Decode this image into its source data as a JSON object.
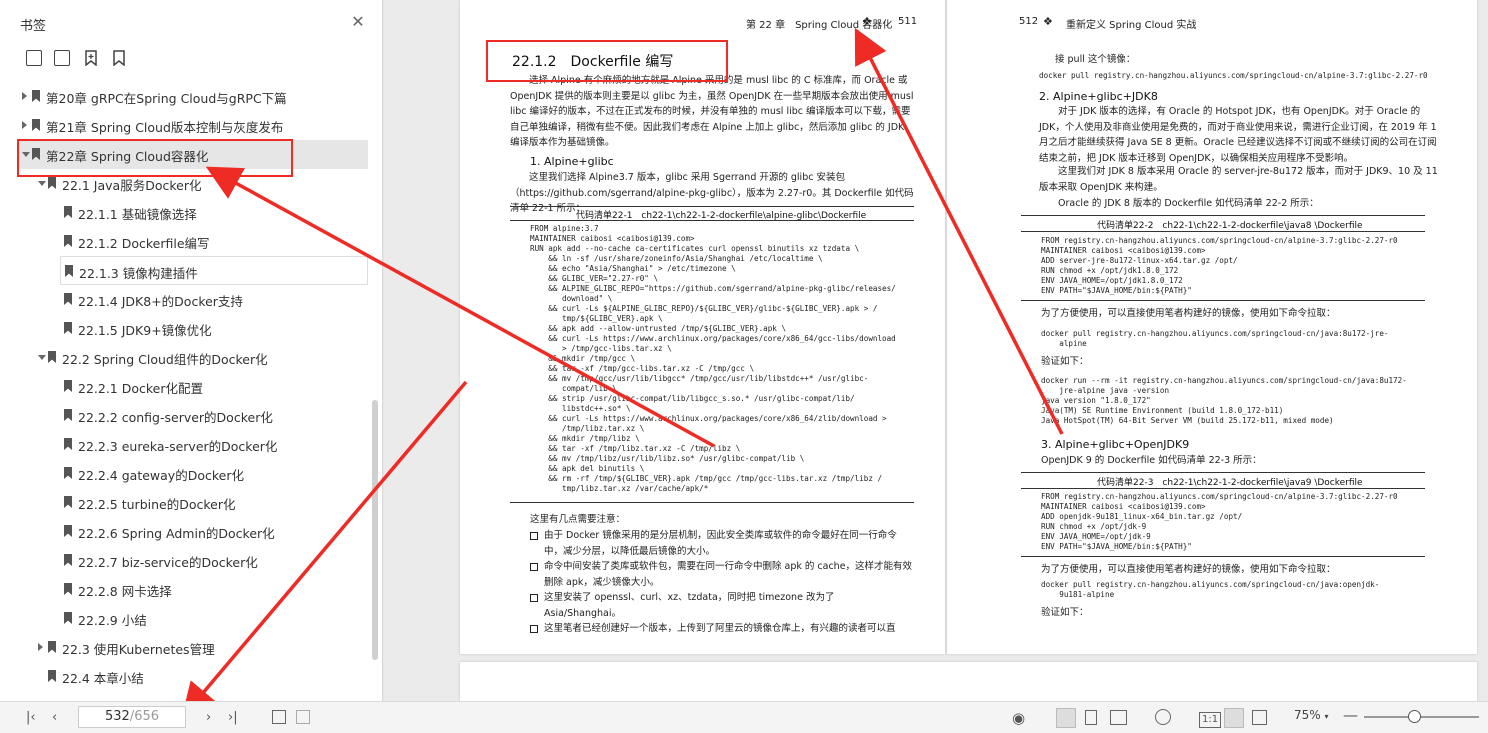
{
  "sidebar": {
    "title": "书签",
    "items": [
      {
        "label": "第20章 gRPC在Spring Cloud与gRPC下篇",
        "state": "collapsed"
      },
      {
        "label": "第21章 Spring Cloud版本控制与灰度发布",
        "state": "collapsed"
      },
      {
        "label": "第22章 Spring Cloud容器化",
        "state": "expanded"
      },
      {
        "label": "22.1 Java服务Docker化",
        "state": "expanded"
      },
      {
        "label": "22.1.1 基础镜像选择"
      },
      {
        "label": "22.1.2 Dockerfile编写"
      },
      {
        "label": "22.1.3 镜像构建插件"
      },
      {
        "label": "22.1.4 JDK8+的Docker支持"
      },
      {
        "label": "22.1.5 JDK9+镜像优化"
      },
      {
        "label": "22.2 Spring Cloud组件的Docker化",
        "state": "expanded"
      },
      {
        "label": "22.2.1 Docker化配置"
      },
      {
        "label": "22.2.2 config-server的Docker化"
      },
      {
        "label": "22.2.3 eureka-server的Docker化"
      },
      {
        "label": "22.2.4 gateway的Docker化"
      },
      {
        "label": "22.2.5 turbine的Docker化"
      },
      {
        "label": "22.2.6 Spring Admin的Docker化"
      },
      {
        "label": "22.2.7 biz-service的Docker化"
      },
      {
        "label": "22.2.8 网卡选择"
      },
      {
        "label": "22.2.9 小结"
      },
      {
        "label": "22.3 使用Kubernetes管理",
        "state": "collapsed"
      },
      {
        "label": "22.4 本章小结"
      }
    ]
  },
  "left_page": {
    "header": "第 22 章　Spring Cloud 容器化",
    "page_number": "511",
    "section_title": "22.1.2　Dockerfile 编写",
    "intro": "选择 Alpine 有个麻烦的地方就是 Alpine 采用的是 musl libc 的 C 标准库，而 Oracle 或 OpenJDK 提供的版本则主要是以 glibc 为主，虽然 OpenJDK 在一些早期版本会放出使用 musl libc 编译好的版本，不过在正式发布的时候，并没有单独的 musl libc 编译版本可以下载，需要自己单独编译，稍微有些不便。因此我们考虑在 Alpine 上加上 glibc，然后添加 glibc 的 JDK 编译版本作为基础镜像。",
    "sub1": "1. Alpine+glibc",
    "sub1_text": "这里我们选择 Alpine3.7 版本，glibc 采用 Sgerrand 开源的 glibc 安装包（https://github.com/sgerrand/alpine-pkg-glibc），版本为 2.27-r0。其 Dockerfile 如代码清单 22-1 所示：",
    "listing1": "代码清单22-1　ch22-1\\ch22-1-2-dockerfile\\alpine-glibc\\Dockerfile",
    "code1": "FROM alpine:3.7\nMAINTAINER caibosi <caibosi@139.com>\nRUN apk add --no-cache ca-certificates curl openssl binutils xz tzdata \\\n    && ln -sf /usr/share/zoneinfo/Asia/Shanghai /etc/localtime \\\n    && echo \"Asia/Shanghai\" > /etc/timezone \\\n    && GLIBC_VER=\"2.27-r0\" \\\n    && ALPINE_GLIBC_REPO=\"https://github.com/sgerrand/alpine-pkg-glibc/releases/\n       download\" \\\n    && curl -Ls ${ALPINE_GLIBC_REPO}/${GLIBC_VER}/glibc-${GLIBC_VER}.apk > /\n       tmp/${GLIBC_VER}.apk \\\n    && apk add --allow-untrusted /tmp/${GLIBC_VER}.apk \\\n    && curl -Ls https://www.archlinux.org/packages/core/x86_64/gcc-libs/download\n       > /tmp/gcc-libs.tar.xz \\\n    && mkdir /tmp/gcc \\\n    && tar -xf /tmp/gcc-libs.tar.xz -C /tmp/gcc \\\n    && mv /tmp/gcc/usr/lib/libgcc* /tmp/gcc/usr/lib/libstdc++* /usr/glibc-\n       compat/lib \\\n    && strip /usr/glibc-compat/lib/libgcc_s.so.* /usr/glibc-compat/lib/\n       libstdc++.so* \\\n    && curl -Ls https://www.archlinux.org/packages/core/x86_64/zlib/download >\n       /tmp/libz.tar.xz \\\n    && mkdir /tmp/libz \\\n    && tar -xf /tmp/libz.tar.xz -C /tmp/libz \\\n    && mv /tmp/libz/usr/lib/libz.so* /usr/glibc-compat/lib \\\n    && apk del binutils \\\n    && rm -rf /tmp/${GLIBC_VER}.apk /tmp/gcc /tmp/gcc-libs.tar.xz /tmp/libz /\n       tmp/libz.tar.xz /var/cache/apk/*",
    "notes_intro": "这里有几点需要注意：",
    "bullets": [
      "由于 Docker 镜像采用的是分层机制，因此安全类库或软件的命令最好在同一行命令中，减少分层，以降低最后镜像的大小。",
      "命令中间安装了类库或软件包，需要在同一行命令中删除 apk 的 cache，这样才能有效删除 apk，减少镜像大小。",
      "这里安装了 openssl、curl、xz、tzdata，同时把 timezone 改为了 Asia/Shanghai。",
      "这里笔者已经创建好一个版本，上传到了阿里云的镜像仓库上，有兴趣的读者可以直"
    ]
  },
  "right_page": {
    "page_number": "512",
    "header": "重新定义 Spring Cloud 实战",
    "pull_label": "接 pull 这个镜像：",
    "pull_cmd": "docker pull registry.cn-hangzhou.aliyuncs.com/springcloud-cn/alpine-3.7:glibc-2.27-r0",
    "sub2": "2. Alpine+glibc+JDK8",
    "sub2_text": "对于 JDK 版本的选择，有 Oracle 的 Hotspot JDK，也有 OpenJDK。对于 Oracle 的 JDK，个人使用及非商业使用是免费的，而对于商业使用来说，需进行企业订阅，在 2019 年 1 月之后才能继续获得 Java SE 8 更新。Oracle 已经建议选择不订阅或不继续订阅的公司在订阅结束之前，把 JDK 版本迁移到 OpenJDK，以确保相关应用程序不受影响。",
    "sub2_text2": "这里我们对 JDK 8 版本采用 Oracle 的 server-jre-8u172 版本，而对于 JDK9、10 及 11 版本采取 OpenJDK 来构建。",
    "sub2_text3": "Oracle 的 JDK 8 版本的 Dockerfile 如代码清单 22-2 所示：",
    "listing2": "代码清单22-2　ch22-1\\ch22-1-2-dockerfile\\java8 \\Dockerfile",
    "code2": "FROM registry.cn-hangzhou.aliyuncs.com/springcloud-cn/alpine-3.7:glibc-2.27-r0\nMAINTAINER caibosi <caibosi@139.com>\nADD server-jre-8u172-linux-x64.tar.gz /opt/\nRUN chmod +x /opt/jdk1.8.0_172\nENV JAVA_HOME=/opt/jdk1.8.0_172\nENV PATH=\"$JAVA_HOME/bin:${PATH}\"",
    "convenience1": "为了方便使用，可以直接使用笔者构建好的镜像，使用如下命令拉取：",
    "pull2": "docker pull registry.cn-hangzhou.aliyuncs.com/springcloud-cn/java:8u172-jre-\n    alpine",
    "verify1": "验证如下：",
    "verify_code": "docker run --rm -it registry.cn-hangzhou.aliyuncs.com/springcloud-cn/java:8u172-\n    jre-alpine java -version\njava version \"1.8.0_172\"\nJava(TM) SE Runtime Environment (build 1.8.0_172-b11)\nJava HotSpot(TM) 64-Bit Server VM (build 25.172-b11, mixed mode)",
    "sub3": "3. Alpine+glibc+OpenJDK9",
    "sub3_text": "OpenJDK 9 的 Dockerfile 如代码清单 22-3 所示：",
    "listing3": "代码清单22-3　ch22-1\\ch22-1-2-dockerfile\\java9 \\Dockerfile",
    "code3": "FROM registry.cn-hangzhou.aliyuncs.com/springcloud-cn/alpine-3.7:glibc-2.27-r0\nMAINTAINER caibosi <caibosi@139.com>\nADD openjdk-9u181_linux-x64_bin.tar.gz /opt/\nRUN chmod +x /opt/jdk-9\nENV JAVA_HOME=/opt/jdk-9\nENV PATH=\"$JAVA_HOME/bin:${PATH}\"",
    "convenience2": "为了方便使用，可以直接使用笔者构建好的镜像，使用如下命令拉取：",
    "pull3": "docker pull registry.cn-hangzhou.aliyuncs.com/springcloud-cn/java:openjdk-\n    9u181-alpine",
    "verify2": "验证如下："
  },
  "bottom_bar": {
    "page_current": "532",
    "page_total": "/656",
    "zoom": "75%"
  },
  "colors": {
    "annotation": "#ee2b24"
  }
}
